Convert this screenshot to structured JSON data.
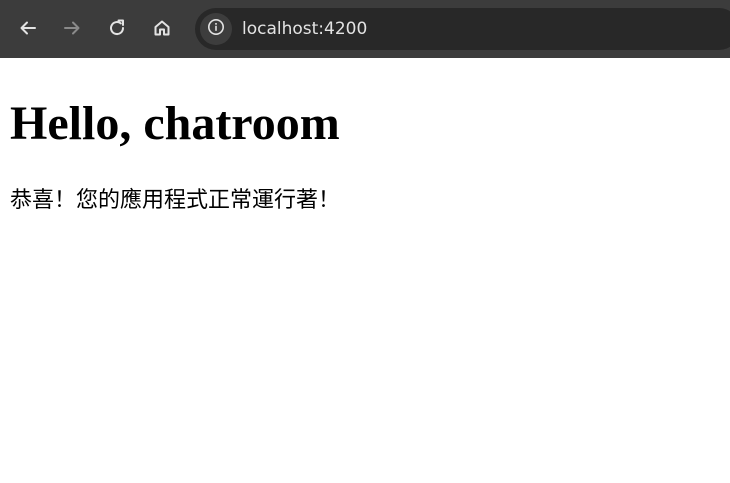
{
  "browser": {
    "url": "localhost:4200",
    "icons": {
      "back": "arrow-left-icon",
      "forward": "arrow-right-icon",
      "reload": "reload-icon",
      "home": "home-icon",
      "site_info": "info-icon"
    }
  },
  "page": {
    "heading": "Hello, chatroom",
    "message": "恭喜！您的應用程式正常運行著！"
  }
}
